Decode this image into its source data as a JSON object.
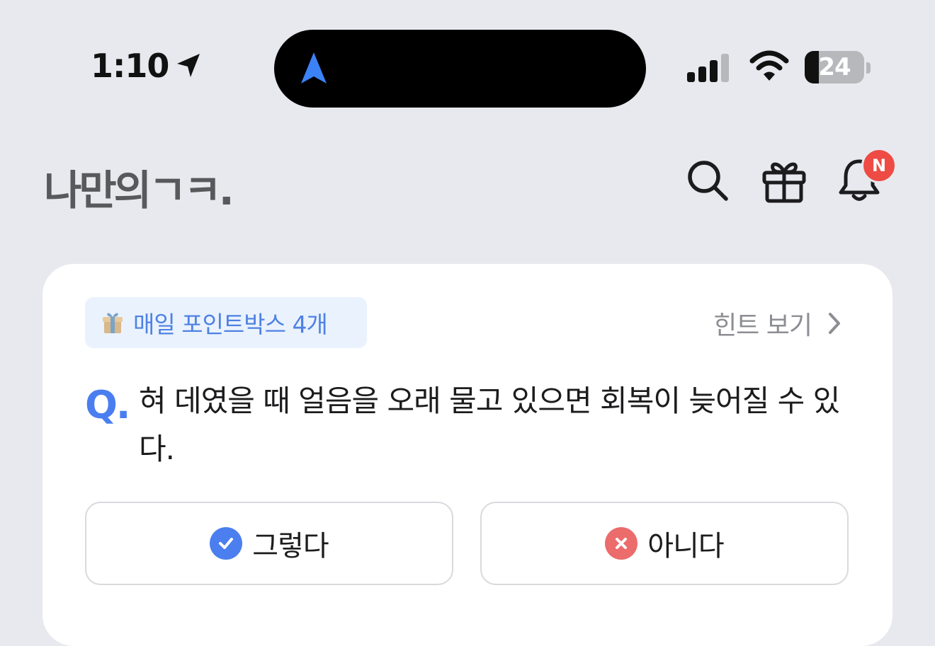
{
  "status_bar": {
    "time": "1:10",
    "battery_level": "24",
    "battery_fraction": 0.24
  },
  "header": {
    "logo_text": "나만의ㄱㅋ.",
    "notification_badge": "N"
  },
  "quiz_card": {
    "points_label": "매일 포인트박스 4개",
    "hint_label": "힌트 보기",
    "question_prefix": "Q.",
    "question_text": "혀 데였을 때 얼음을 오래 물고 있으면 회복이 늦어질 수 있다.",
    "answer_yes": "그렇다",
    "answer_no": "아니다"
  },
  "colors": {
    "background": "#e8e9ee",
    "accent_blue": "#4a7ef0",
    "badge_red": "#ee4b44",
    "no_red": "#ec6b6b"
  }
}
